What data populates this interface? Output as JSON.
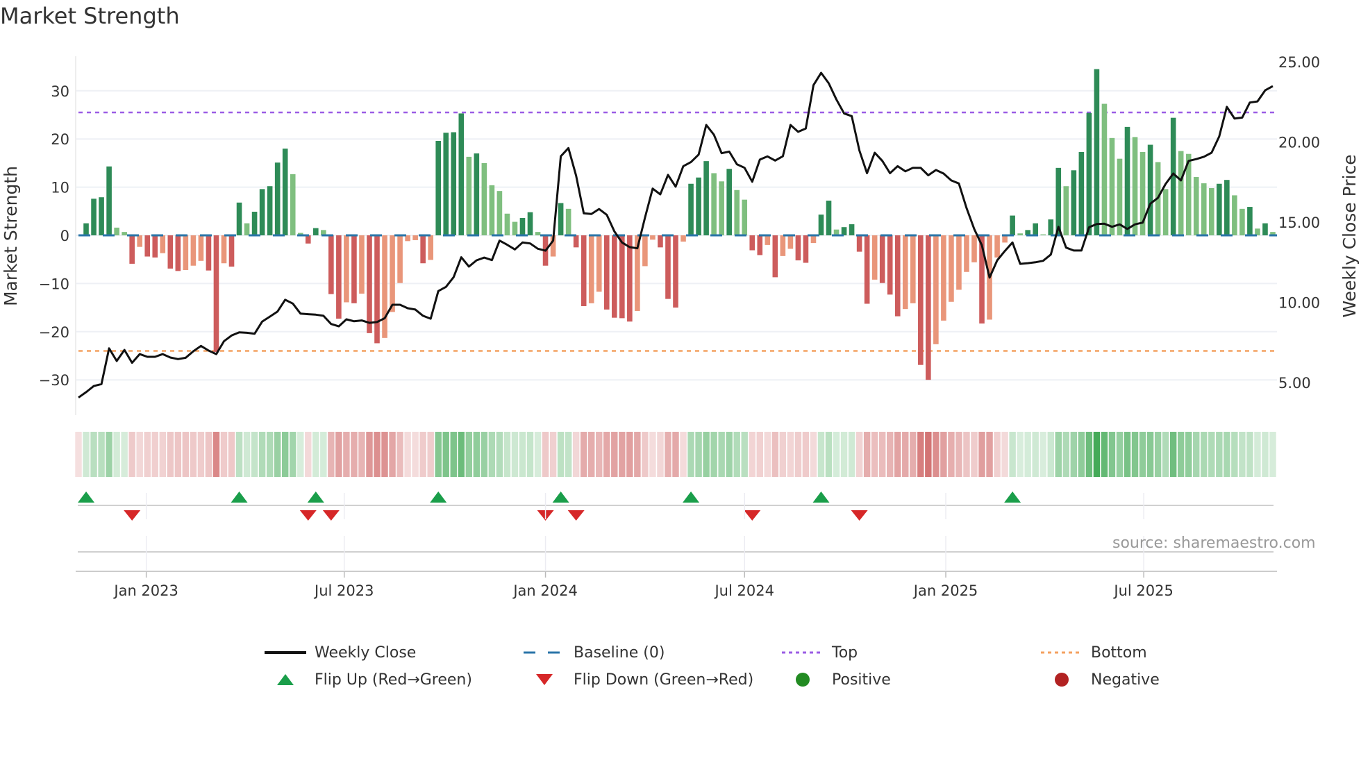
{
  "title": "Market Strength",
  "source_note": "source: sharemaestro.com",
  "legend": {
    "weekly_close": "Weekly Close",
    "baseline": "Baseline (0)",
    "top": "Top",
    "bottom": "Bottom",
    "flip_up": "Flip Up (Red→Green)",
    "flip_down": "Flip Down (Green→Red)",
    "positive": "Positive",
    "negative": "Negative"
  },
  "colors": {
    "pos_rising": "#2e8b57",
    "pos_falling": "#7fbf7f",
    "neg_falling": "#cd5c5c",
    "neg_rising": "#e9967a",
    "baseline": "#2a75a8",
    "top": "#9b5de5",
    "bottom": "#f4a261",
    "close": "#111111",
    "flip_up": "#1a9e4a",
    "flip_down": "#d62728",
    "positive": "#228b22",
    "negative": "#b22222"
  },
  "chart_data": {
    "type": "bar+line",
    "title": "Market Strength",
    "ylabel": "Market Strength",
    "y2label": "Weekly Close Price",
    "ylim": [
      -36,
      38
    ],
    "y2lim": [
      3.1,
      26.1
    ],
    "yticks": [
      "30",
      "20",
      "10",
      "0",
      "−10",
      "−20",
      "−30"
    ],
    "ytick_values": [
      30,
      20,
      10,
      0,
      -10,
      -20,
      -30
    ],
    "y2ticks": [
      "25.00",
      "20.00",
      "15.00",
      "10.00",
      "5.00"
    ],
    "y2tick_values": [
      25,
      20,
      15,
      10,
      5
    ],
    "xticks": [
      "Jan 2023",
      "Jul 2023",
      "Jan 2024",
      "Jul 2024",
      "Jan 2025",
      "Jul 2025"
    ],
    "xtick_dates": [
      "2023-01-01",
      "2023-07-01",
      "2024-01-01",
      "2024-07-01",
      "2025-01-01",
      "2025-07-01"
    ],
    "x_start": "2022-10-31",
    "x_interval_days": 7,
    "top_level": 25.5,
    "bottom_level": -24,
    "baseline": 0,
    "grid": true,
    "legend_position": "bottom",
    "strength": [
      0,
      2.5,
      7.6,
      7.9,
      14.3,
      1.6,
      0.7,
      -5.9,
      -2.4,
      -4.4,
      -4.6,
      -3.7,
      -6.9,
      -7.4,
      -7.2,
      -6.3,
      -5.3,
      -7.3,
      -24.2,
      -5.8,
      -6.5,
      6.8,
      2.5,
      4.9,
      9.6,
      10.2,
      15.1,
      18.0,
      12.7,
      0.5,
      -1.7,
      1.5,
      1.1,
      -12.2,
      -17.3,
      -13.9,
      -14.1,
      -12.1,
      -20.3,
      -22.4,
      -21.3,
      -15.9,
      -9.9,
      -1.2,
      -1.0,
      -5.8,
      -5.1,
      19.6,
      21.3,
      21.4,
      25.3,
      16.3,
      17.0,
      15.0,
      10.4,
      9.2,
      4.5,
      2.8,
      3.6,
      4.8,
      0.7,
      -6.3,
      -4.4,
      6.7,
      5.5,
      -2.5,
      -14.7,
      -14.1,
      -11.7,
      -15.4,
      -17.1,
      -17.2,
      -17.9,
      -15.7,
      -6.4,
      -0.9,
      -2.5,
      -13.2,
      -15.0,
      -1.3,
      10.7,
      12.0,
      15.4,
      12.9,
      11.2,
      13.8,
      9.4,
      7.4,
      -3.1,
      -4.1,
      -2.0,
      -8.7,
      -4.3,
      -2.8,
      -5.2,
      -5.7,
      -1.6,
      4.3,
      7.2,
      1.2,
      1.7,
      2.3,
      -3.4,
      -14.2,
      -9.2,
      -9.9,
      -12.3,
      -16.8,
      -15.3,
      -14.1,
      -26.9,
      -30.0,
      -22.6,
      -17.7,
      -13.8,
      -11.3,
      -7.6,
      -5.6,
      -18.3,
      -17.5,
      -4.6,
      -1.5,
      4.1,
      0.4,
      1.1,
      2.5,
      0.2,
      3.3,
      14.0,
      10.2,
      13.5,
      17.3,
      25.4,
      34.5,
      27.3,
      20.2,
      15.9,
      22.5,
      20.4,
      17.3,
      18.8,
      15.2,
      9.6,
      24.4,
      17.5,
      16.9,
      12.1,
      10.8,
      9.8,
      10.7,
      11.5,
      8.3,
      5.5,
      5.9,
      1.4,
      2.5,
      0.7
    ],
    "weekly_close": [
      4.06,
      4.4,
      4.78,
      4.9,
      7.13,
      6.34,
      7.03,
      6.23,
      6.77,
      6.6,
      6.6,
      6.77,
      6.56,
      6.46,
      6.54,
      6.95,
      7.28,
      6.99,
      6.77,
      7.57,
      7.93,
      8.13,
      8.1,
      8.04,
      8.8,
      9.11,
      9.43,
      10.16,
      9.92,
      9.3,
      9.26,
      9.23,
      9.16,
      8.65,
      8.5,
      8.94,
      8.82,
      8.87,
      8.72,
      8.77,
      9.01,
      9.85,
      9.85,
      9.63,
      9.55,
      9.16,
      8.98,
      10.7,
      10.96,
      11.57,
      12.81,
      12.23,
      12.62,
      12.79,
      12.63,
      13.85,
      13.59,
      13.3,
      13.73,
      13.67,
      13.34,
      13.22,
      13.85,
      19.11,
      19.62,
      17.89,
      15.55,
      15.51,
      15.82,
      15.46,
      14.42,
      13.73,
      13.44,
      13.37,
      15.29,
      17.09,
      16.73,
      17.95,
      17.21,
      18.49,
      18.75,
      19.21,
      21.06,
      20.45,
      19.3,
      19.4,
      18.61,
      18.39,
      17.52,
      18.9,
      19.1,
      18.84,
      19.11,
      21.06,
      20.63,
      20.84,
      23.54,
      24.31,
      23.66,
      22.65,
      21.78,
      21.61,
      19.47,
      18.05,
      19.33,
      18.82,
      18.05,
      18.49,
      18.17,
      18.39,
      18.39,
      17.92,
      18.25,
      18.03,
      17.6,
      17.41,
      15.87,
      14.57,
      13.56,
      11.54,
      12.62,
      13.2,
      13.73,
      12.4,
      12.44,
      12.5,
      12.59,
      12.98,
      14.71,
      13.41,
      13.23,
      13.23,
      14.68,
      14.88,
      14.9,
      14.71,
      14.86,
      14.57,
      14.86,
      14.97,
      16.15,
      16.52,
      17.38,
      18.03,
      17.6,
      18.82,
      18.93,
      19.08,
      19.33,
      20.34,
      22.19,
      21.46,
      21.52,
      22.46,
      22.53,
      23.22,
      23.48
    ]
  }
}
